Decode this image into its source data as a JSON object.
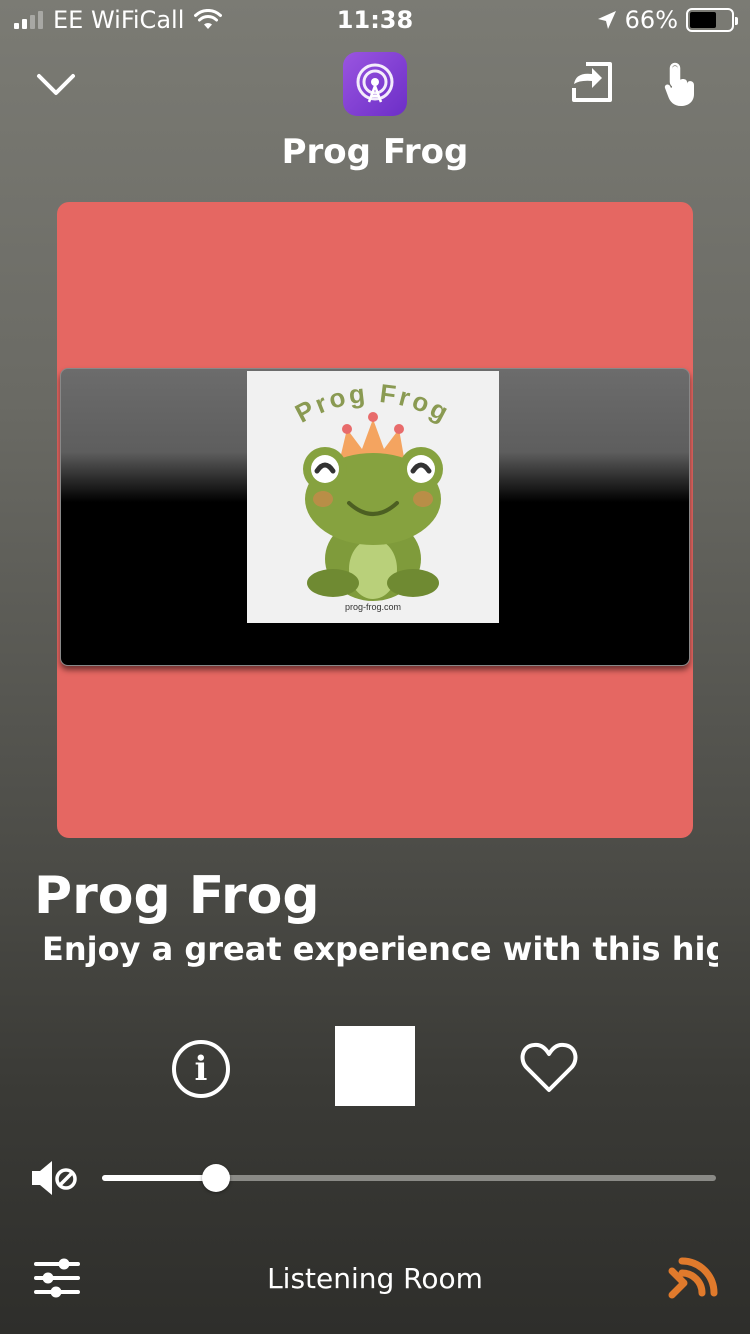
{
  "status_bar": {
    "carrier": "EE WiFiCall",
    "time": "11:38",
    "battery_percent": "66%",
    "battery_level": 0.66,
    "signal_bars_filled": 2,
    "signal_bars_total": 4
  },
  "header": {
    "title": "Prog Frog",
    "icons": [
      "chevron-down-icon",
      "podcast-app-icon",
      "airplay-output-icon",
      "touch-gesture-icon"
    ]
  },
  "artwork": {
    "background_color": "#e56762",
    "logo_arc_text": "Prog Frog",
    "logo_url_text": "prog-frog.com"
  },
  "now_playing": {
    "station_name": "Prog Frog",
    "description": "Enjoy a great experience with this highly"
  },
  "controls": {
    "icons": [
      "info-icon",
      "stop-icon",
      "heart-icon"
    ]
  },
  "volume": {
    "level": 0.186,
    "icon": "mute-speaker-icon"
  },
  "bottom_bar": {
    "room_name": "Listening Room",
    "icons": [
      "equalizer-settings-icon",
      "sonos-cast-icon"
    ],
    "accent_color": "#e07a2c"
  }
}
